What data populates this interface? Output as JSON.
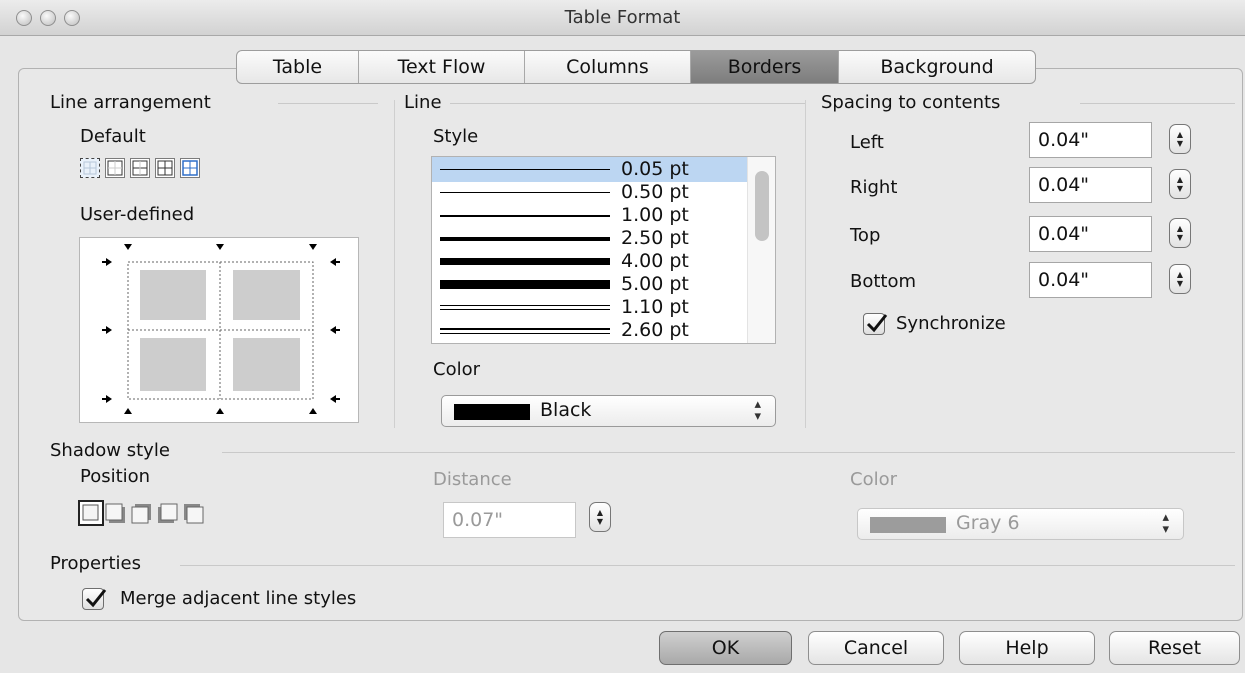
{
  "window": {
    "title": "Table Format"
  },
  "tabs": [
    {
      "label": "Table"
    },
    {
      "label": "Text Flow"
    },
    {
      "label": "Columns"
    },
    {
      "label": "Borders",
      "selected": true
    },
    {
      "label": "Background"
    }
  ],
  "line_arrangement": {
    "title": "Line arrangement",
    "default_label": "Default",
    "user_defined_label": "User-defined",
    "default_icons": [
      "no-borders-icon",
      "outer-border-icon",
      "outer-border-horizontal-icon",
      "outer-border-all-inner-icon",
      "outer-border-no-inner-icon"
    ]
  },
  "line": {
    "title": "Line",
    "style_label": "Style",
    "styles": [
      {
        "value": "0.05 pt",
        "selected": true
      },
      {
        "value": "0.50 pt"
      },
      {
        "value": "1.00 pt"
      },
      {
        "value": "2.50 pt"
      },
      {
        "value": "4.00 pt"
      },
      {
        "value": "5.00 pt"
      },
      {
        "value": "1.10 pt"
      },
      {
        "value": "2.60 pt"
      }
    ],
    "color_label": "Color",
    "color_value": "Black",
    "color_swatch": "#000000"
  },
  "spacing": {
    "title": "Spacing to contents",
    "fields": [
      {
        "label": "Left",
        "value": "0.04\""
      },
      {
        "label": "Right",
        "value": "0.04\""
      },
      {
        "label": "Top",
        "value": "0.04\""
      },
      {
        "label": "Bottom",
        "value": "0.04\""
      }
    ],
    "synchronize_label": "Synchronize",
    "synchronize_checked": true
  },
  "shadow": {
    "title": "Shadow style",
    "position_label": "Position",
    "distance_label": "Distance",
    "distance_value": "0.07\"",
    "color_label": "Color",
    "color_value": "Gray 6",
    "color_swatch": "#9c9c9c"
  },
  "properties": {
    "title": "Properties",
    "merge_label": "Merge adjacent line styles",
    "merge_checked": true
  },
  "buttons": {
    "ok": "OK",
    "cancel": "Cancel",
    "help": "Help",
    "reset": "Reset"
  }
}
